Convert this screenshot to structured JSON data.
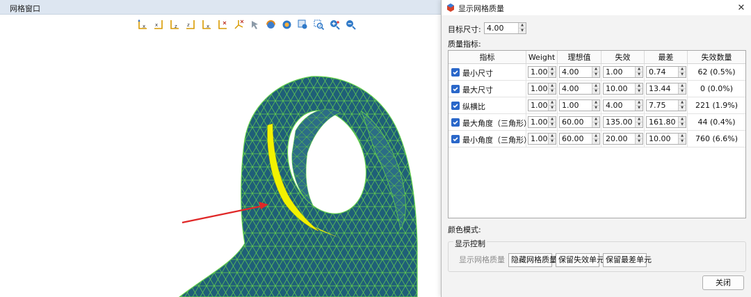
{
  "mesh_window": {
    "title": "网格窗口",
    "toolbar_icons": [
      "axis-y-x-icon",
      "axis-x-y-icon",
      "axis-y-z-icon",
      "axis-z-y-icon",
      "axis-z-x-icon",
      "axis-x-z-icon",
      "axis-isometric-icon",
      "select-arrow-icon",
      "rotate-icon",
      "fit-view-icon",
      "zoom-box-icon",
      "zoom-window-icon",
      "zoom-in-icon",
      "zoom-out-icon"
    ]
  },
  "dialog": {
    "title": "显示网格质量",
    "target_size_label": "目标尺寸:",
    "target_size_value": "4.00",
    "metrics_label": "质量指标:",
    "columns": [
      "指标",
      "Weight",
      "理想值",
      "失效",
      "最差",
      "失效数量"
    ],
    "rows": [
      {
        "name": "最小尺寸",
        "checked": true,
        "weight": "1.00",
        "ideal": "4.00",
        "fail": "1.00",
        "worst": "0.74",
        "fail_count": "62 (0.5%)"
      },
      {
        "name": "最大尺寸",
        "checked": true,
        "weight": "1.00",
        "ideal": "4.00",
        "fail": "10.00",
        "worst": "13.44",
        "fail_count": "0 (0.0%)"
      },
      {
        "name": "纵横比",
        "checked": true,
        "weight": "1.00",
        "ideal": "1.00",
        "fail": "4.00",
        "worst": "7.75",
        "fail_count": "221 (1.9%)"
      },
      {
        "name": "最大角度（三角形）",
        "checked": true,
        "weight": "1.00",
        "ideal": "60.00",
        "fail": "135.00",
        "worst": "161.80",
        "fail_count": "44 (0.4%)"
      },
      {
        "name": "最小角度（三角形）",
        "checked": true,
        "weight": "1.00",
        "ideal": "60.00",
        "fail": "20.00",
        "worst": "10.00",
        "fail_count": "760 (6.6%)"
      }
    ],
    "color_mode_label": "颜色模式:",
    "display_control_label": "显示控制",
    "show_quality_button": "显示网格质量",
    "hide_quality_button": "隐藏网格质量",
    "keep_failed_button": "保留失效单元",
    "keep_worst_button": "保留最差单元",
    "close_button": "关闭",
    "accent_color": "#2a67c9"
  },
  "colors": {
    "mesh_fill": "#1f5f78",
    "mesh_edge": "#66d14e",
    "highlight": "#f2f200",
    "arrow": "#e02828"
  }
}
